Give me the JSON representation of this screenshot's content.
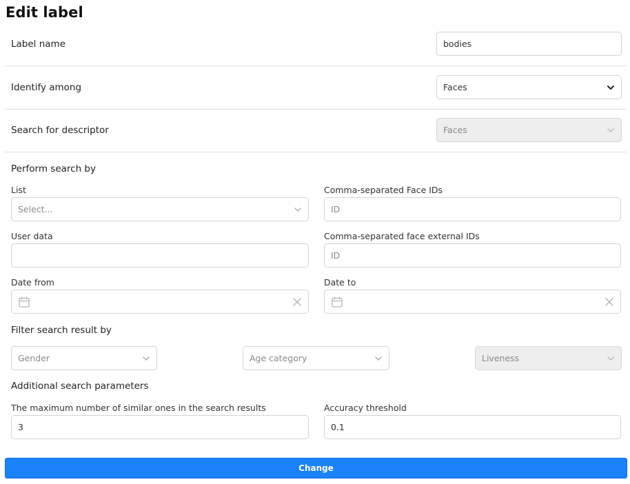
{
  "page": {
    "title": "Edit label"
  },
  "label_name": {
    "label": "Label name",
    "value": "bodies"
  },
  "identify_among": {
    "label": "Identify among",
    "value": "Faces"
  },
  "search_descriptor": {
    "label": "Search for descriptor",
    "value": "Faces"
  },
  "perform_search": {
    "title": "Perform search by",
    "list": {
      "label": "List",
      "placeholder": "Select..."
    },
    "face_ids": {
      "label": "Comma-separated Face IDs",
      "placeholder": "ID"
    },
    "user_data": {
      "label": "User data",
      "value": ""
    },
    "external_ids": {
      "label": "Comma-separated face external IDs",
      "placeholder": "ID"
    },
    "date_from": {
      "label": "Date from"
    },
    "date_to": {
      "label": "Date to"
    }
  },
  "filter": {
    "title": "Filter search result by",
    "gender": {
      "placeholder": "Gender"
    },
    "age": {
      "placeholder": "Age category"
    },
    "liveness": {
      "placeholder": "Liveness"
    }
  },
  "additional": {
    "title": "Additional search parameters",
    "max_similar": {
      "label": "The maximum number of similar ones in the search results",
      "value": "3"
    },
    "accuracy": {
      "label": "Accuracy threshold",
      "value": "0.1"
    }
  },
  "submit": {
    "label": "Change"
  },
  "colors": {
    "primary": "#1a82fb",
    "border": "#ced4da",
    "disabled_bg": "#eeeeee"
  }
}
